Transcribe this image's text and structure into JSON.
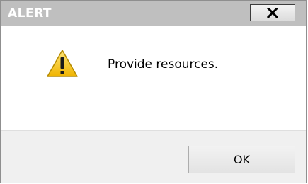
{
  "dialog": {
    "title": "ALERT",
    "message": "Provide resources.",
    "ok_label": "OK"
  },
  "icons": {
    "close": "close-icon",
    "warning": "warning-icon"
  },
  "colors": {
    "titlebar": "#bfbfbf",
    "title_text": "#ffffff",
    "content_bg": "#ffffff",
    "footer_bg": "#f0f0f0",
    "warning_yellow": "#f7c515"
  }
}
